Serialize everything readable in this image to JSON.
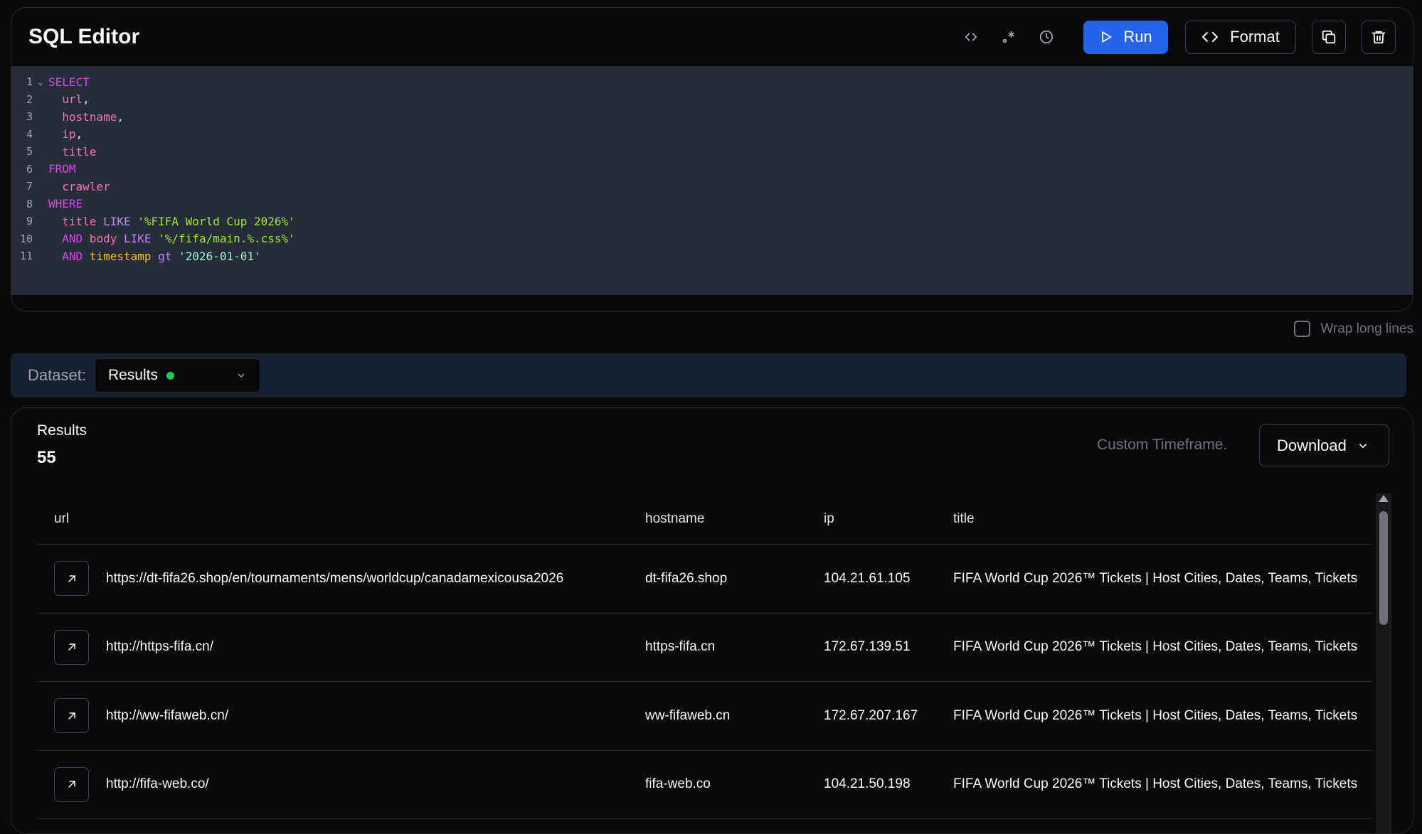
{
  "editor": {
    "title": "SQL Editor",
    "run_label": "Run",
    "format_label": "Format",
    "icons": [
      "code-icon",
      "regex-icon",
      "history-icon",
      "play-icon",
      "copy-icon",
      "trash-icon"
    ]
  },
  "code_lines": [
    {
      "n": "1",
      "fold": "⌄",
      "segs": [
        {
          "t": "SELECT",
          "c": "kw"
        }
      ]
    },
    {
      "n": "2",
      "segs": [
        {
          "t": "  url",
          "c": "id"
        },
        {
          "t": ",",
          "c": ""
        }
      ]
    },
    {
      "n": "3",
      "segs": [
        {
          "t": "  hostname",
          "c": "id"
        },
        {
          "t": ",",
          "c": ""
        }
      ]
    },
    {
      "n": "4",
      "segs": [
        {
          "t": "  ip",
          "c": "id"
        },
        {
          "t": ",",
          "c": ""
        }
      ]
    },
    {
      "n": "5",
      "segs": [
        {
          "t": "  title",
          "c": "id"
        }
      ]
    },
    {
      "n": "6",
      "segs": [
        {
          "t": "FROM",
          "c": "kw"
        }
      ]
    },
    {
      "n": "7",
      "segs": [
        {
          "t": "  crawler",
          "c": "id"
        }
      ]
    },
    {
      "n": "8",
      "segs": [
        {
          "t": "WHERE",
          "c": "kw"
        }
      ]
    },
    {
      "n": "9",
      "segs": [
        {
          "t": "  title",
          "c": "id"
        },
        {
          "t": " LIKE ",
          "c": "kw2"
        },
        {
          "t": "'%FIFA World Cup 2026%'",
          "c": "str"
        }
      ]
    },
    {
      "n": "10",
      "segs": [
        {
          "t": "  AND",
          "c": "kw"
        },
        {
          "t": " body",
          "c": "id"
        },
        {
          "t": " LIKE ",
          "c": "kw2"
        },
        {
          "t": "'%/fifa/main.%.css%'",
          "c": "str"
        }
      ]
    },
    {
      "n": "11",
      "segs": [
        {
          "t": "  AND",
          "c": "kw"
        },
        {
          "t": " timestamp",
          "c": "fn"
        },
        {
          "t": " gt ",
          "c": "kw2"
        },
        {
          "t": "'2026-01-01'",
          "c": "cstr"
        }
      ]
    }
  ],
  "wrap_label": "Wrap long lines",
  "dataset": {
    "label": "Dataset:",
    "selected": "Results",
    "status_color": "#22c55e"
  },
  "results": {
    "title": "Results",
    "count": "55",
    "timeframe": "Custom Timeframe.",
    "download_label": "Download",
    "columns": [
      "url",
      "hostname",
      "ip",
      "title"
    ],
    "rows": [
      {
        "url": "https://dt-fifa26.shop/en/tournaments/mens/worldcup/canadamexicousa2026",
        "hostname": "dt-fifa26.shop",
        "ip": "104.21.61.105",
        "title": "FIFA World Cup 2026™ Tickets | Host Cities, Dates, Teams, Tickets"
      },
      {
        "url": "http://https-fifa.cn/",
        "hostname": "https-fifa.cn",
        "ip": "172.67.139.51",
        "title": "FIFA World Cup 2026™ Tickets | Host Cities, Dates, Teams, Tickets"
      },
      {
        "url": "http://ww-fifaweb.cn/",
        "hostname": "ww-fifaweb.cn",
        "ip": "172.67.207.167",
        "title": "FIFA World Cup 2026™ Tickets | Host Cities, Dates, Teams, Tickets"
      },
      {
        "url": "http://fifa-web.co/",
        "hostname": "fifa-web.co",
        "ip": "104.21.50.198",
        "title": "FIFA World Cup 2026™ Tickets | Host Cities, Dates, Teams, Tickets"
      }
    ]
  },
  "colors": {
    "accent": "#2563eb",
    "editor_bg": "#262c38",
    "dataset_bar": "#172033"
  }
}
